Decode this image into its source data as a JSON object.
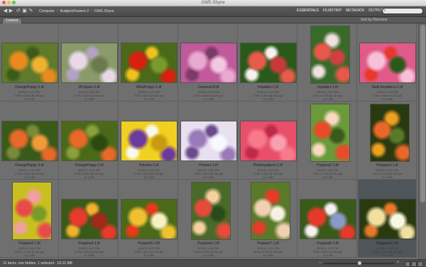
{
  "window": {
    "title": "GWE-Shyne"
  },
  "toolbar": {
    "breadcrumbs": [
      "Computer",
      "BudgetoFlowers-2",
      "GWE-Shyne"
    ],
    "workspaces": [
      "ESSENTIALS",
      "FILMSTRIP",
      "METADATA",
      "OUTPUT"
    ],
    "sort_label": "Sort by Filename",
    "search_placeholder": ""
  },
  "panel": {
    "tab_label": "Content"
  },
  "status": {
    "text": "31 items, one hidden, 1 selected - 18.22 MB",
    "zoom_fraction": 0.5
  },
  "thumbnails": [
    {
      "name": "OrangePoppy-1.tif",
      "meta": [
        "8/15/11, 6:22 PM",
        "2736 x 1824 @ 240 ppi",
        "14.3 MB"
      ],
      "orientation": "land",
      "palette": [
        "#5f7a2a",
        "#e88a1d",
        "#3c5a1a",
        "#f0b030"
      ]
    },
    {
      "name": "2Poppies-1.tif",
      "meta": [
        "8/15/11, 6:22 PM",
        "2736 x 1824 @ 240 ppi",
        "14.3 MB"
      ],
      "orientation": "land",
      "palette": [
        "#8a9a6a",
        "#e8d8e8",
        "#b5a0c8",
        "#6a7a4a"
      ]
    },
    {
      "name": "3RedPoppy-1.tif",
      "meta": [
        "8/15/11, 6:22 PM",
        "2736 x 1824 @ 240 ppi",
        "14.3 MB"
      ],
      "orientation": "land",
      "palette": [
        "#4a6a1a",
        "#d82010",
        "#f0c020",
        "#7a9a2a"
      ]
    },
    {
      "name": "Carvenel-8.tif",
      "meta": [
        "8/15/11, 6:22 PM",
        "2736 x 1824 @ 240 ppi",
        "14.3 MB"
      ],
      "orientation": "land",
      "palette": [
        "#c05a9a",
        "#e8a8d0",
        "#7a3a6a",
        "#f0c8e0"
      ]
    },
    {
      "name": "Impatien-1.tif",
      "meta": [
        "8/15/11, 6:22 PM",
        "2736 x 1824 @ 240 ppi",
        "14.3 MB"
      ],
      "orientation": "land",
      "palette": [
        "#2a5a1a",
        "#e85a4a",
        "#f8f0f0",
        "#c83a3a"
      ]
    },
    {
      "name": "Impatien-1.tif",
      "meta": [
        "8/15/11, 6:22 PM",
        "1824 x 2736 @ 240 ppi",
        "14.3 MB"
      ],
      "orientation": "port",
      "palette": [
        "#3a6a2a",
        "#e8584a",
        "#f0e0e0",
        "#d04040"
      ]
    },
    {
      "name": "Multi-Impatiens-1.tif",
      "meta": [
        "8/15/11, 6:22 PM",
        "2736 x 1824 @ 240 ppi",
        "14.3 MB"
      ],
      "orientation": "land",
      "palette": [
        "#e05a8a",
        "#f8c0d8",
        "#e8382a",
        "#2a5a1a"
      ]
    },
    {
      "name": "OrangePoppy-1.tif",
      "meta": [
        "8/15/11, 6:22 PM",
        "2736 x 1824 @ 240 ppi",
        "14.3 MB"
      ],
      "orientation": "land",
      "palette": [
        "#3a5a1a",
        "#e8682a",
        "#7a8a3a",
        "#f09a3a"
      ]
    },
    {
      "name": "OrangePoppy-1.tif",
      "meta": [
        "8/15/11, 6:22 PM",
        "2736 x 1824 @ 240 ppi",
        "14.3 MB"
      ],
      "orientation": "land",
      "palette": [
        "#4a6a1a",
        "#e8682a",
        "#8aa03a",
        "#2a4a10"
      ]
    },
    {
      "name": "Pansies-1.tif",
      "meta": [
        "8/15/11, 6:22 PM",
        "2736 x 1824 @ 240 ppi",
        "14.3 MB"
      ],
      "orientation": "land",
      "palette": [
        "#f0d020",
        "#6a3aa0",
        "#f8f8f0",
        "#c89a10"
      ]
    },
    {
      "name": "Petunia-1.tif",
      "meta": [
        "8/15/11, 6:22 PM",
        "2736 x 1824 @ 240 ppi",
        "14.3 MB"
      ],
      "orientation": "land",
      "palette": [
        "#e8e0f0",
        "#9a7ab8",
        "#6a4a8a",
        "#f8f8ff"
      ]
    },
    {
      "name": "PinkImpatiens-1.tif",
      "meta": [
        "8/15/11, 6:22 PM",
        "2736 x 1824 @ 240 ppi",
        "14.3 MB"
      ],
      "orientation": "land",
      "palette": [
        "#e8506a",
        "#f87a8a",
        "#c02a4a",
        "#f8a0b0"
      ]
    },
    {
      "name": "Poppies3-1.tif",
      "meta": [
        "8/15/11, 6:22 PM",
        "1824 x 2736 @ 240 ppi",
        "14.3 MB"
      ],
      "orientation": "port",
      "palette": [
        "#6a9a3a",
        "#e84a2a",
        "#f8d8c0",
        "#3a5a1a"
      ]
    },
    {
      "name": "Poppies3-1.tif",
      "meta": [
        "8/15/11, 6:22 PM",
        "1824 x 2736 @ 240 ppi",
        "14.3 MB"
      ],
      "orientation": "port",
      "palette": [
        "#2a3a10",
        "#e8682a",
        "#f0a020",
        "#5a7a2a"
      ]
    },
    {
      "name": "Poppies3-1.tif",
      "meta": [
        "8/15/11, 6:22 PM",
        "1824 x 2736 @ 240 ppi",
        "14.3 MB"
      ],
      "orientation": "port",
      "palette": [
        "#c8c020",
        "#e84a4a",
        "#f0a0a0",
        "#7a9a2a"
      ]
    },
    {
      "name": "Poppies4-1.tif",
      "meta": [
        "8/15/11, 6:22 PM",
        "2736 x 1824 @ 240 ppi",
        "14.3 MB"
      ],
      "orientation": "land",
      "palette": [
        "#3a5a1a",
        "#e83a2a",
        "#f0b030",
        "#a02a1a"
      ]
    },
    {
      "name": "Poppies5-1.tif",
      "meta": [
        "8/15/11, 6:22 PM",
        "2736 x 1824 @ 240 ppi",
        "14.3 MB"
      ],
      "orientation": "land",
      "palette": [
        "#4a6a1a",
        "#f0c030",
        "#e83a1a",
        "#f8f0c0"
      ]
    },
    {
      "name": "Poppies6-1.tif",
      "meta": [
        "8/15/11, 6:22 PM",
        "1824 x 2736 @ 240 ppi",
        "14.3 MB"
      ],
      "orientation": "port",
      "palette": [
        "#4a6a2a",
        "#e84a3a",
        "#f8d0a0",
        "#2a4a1a"
      ]
    },
    {
      "name": "Poppies7-1.tif",
      "meta": [
        "8/15/11, 6:22 PM",
        "1824 x 2736 @ 240 ppi",
        "14.3 MB"
      ],
      "orientation": "port",
      "palette": [
        "#5a7a2a",
        "#f0d0b0",
        "#e83a2a",
        "#f8f0e0"
      ]
    },
    {
      "name": "Poppies8-1.tif",
      "meta": [
        "8/15/11, 6:22 PM",
        "2736 x 1824 @ 240 ppi",
        "14.3 MB"
      ],
      "orientation": "land",
      "palette": [
        "#3a5a1a",
        "#e8382a",
        "#f8f0f0",
        "#8a9ac8"
      ]
    },
    {
      "name": "Poppies9-1.tif",
      "meta": [
        "8/15/11, 6:22 PM",
        "2736 x 1824 @ 240 ppi",
        "14.3 MB"
      ],
      "orientation": "land",
      "palette": [
        "#2a3a10",
        "#f0e0a0",
        "#e8782a",
        "#f8f8e0"
      ],
      "selected": true
    }
  ]
}
